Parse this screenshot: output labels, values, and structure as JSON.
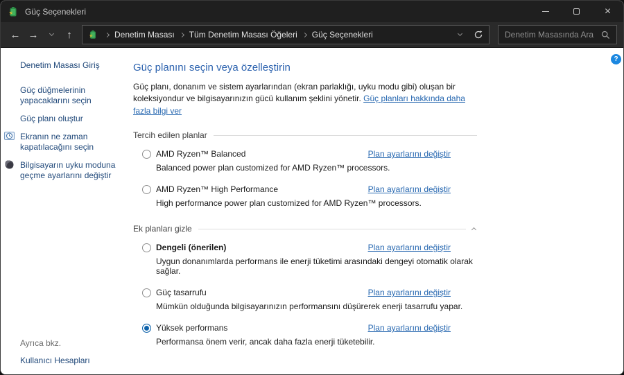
{
  "window": {
    "title": "Güç Seçenekleri"
  },
  "icons": {
    "back": "←",
    "forward": "→",
    "up": "↑",
    "close": "×",
    "help": "?",
    "power_icon_color": "#3aa650",
    "power_bolt_color": "#f2c230"
  },
  "navbar": {
    "breadcrumb": [
      "Denetim Masası",
      "Tüm Denetim Masası Öğeleri",
      "Güç Seçenekleri"
    ],
    "search": {
      "placeholder": "Denetim Masasında Ara"
    }
  },
  "sidebar": {
    "home": "Denetim Masası Giriş",
    "tasks": [
      {
        "label": "Güç düğmelerinin yapacaklarını seçin",
        "icon": ""
      },
      {
        "label": "Güç planı oluştur",
        "icon": ""
      },
      {
        "label": "Ekranın ne zaman kapatılacağını seçin",
        "icon": "display-clock-icon"
      },
      {
        "label": "Bilgisayarın uyku moduna geçme ayarlarını değiştir",
        "icon": "sleep-moon-icon"
      }
    ],
    "see_also": {
      "label": "Ayrıca bkz.",
      "links": [
        "Kullanıcı Hesapları"
      ]
    }
  },
  "main": {
    "heading": "Güç planını seçin veya özelleştirin",
    "intro_text": "Güç planı, donanım ve sistem ayarlarından (ekran parlaklığı, uyku modu gibi) oluşan bir koleksiyondur ve bilgisayarınızın gücü kullanım şeklini yönetir.",
    "intro_link": "Güç planları hakkında daha fazla bilgi ver",
    "groups": [
      {
        "title": "Tercih edilen planlar",
        "collapsible": false,
        "plans": [
          {
            "name": "AMD Ryzen™ Balanced",
            "description": "Balanced power plan customized for AMD Ryzen™ processors.",
            "selected": false,
            "bold": false,
            "link": "Plan ayarlarını değiştir"
          },
          {
            "name": "AMD Ryzen™ High Performance",
            "description": "High performance power plan customized for AMD Ryzen™ processors.",
            "selected": false,
            "bold": false,
            "link": "Plan ayarlarını değiştir"
          }
        ]
      },
      {
        "title": "Ek planları gizle",
        "collapsible": true,
        "plans": [
          {
            "name": "Dengeli (önerilen)",
            "description": "Uygun donanımlarda performans ile enerji tüketimi arasındaki dengeyi otomatik olarak sağlar.",
            "selected": false,
            "bold": true,
            "link": "Plan ayarlarını değiştir"
          },
          {
            "name": "Güç tasarrufu",
            "description": "Mümkün olduğunda bilgisayarınızın performansını düşürerek enerji tasarrufu yapar.",
            "selected": false,
            "bold": false,
            "link": "Plan ayarlarını değiştir"
          },
          {
            "name": "Yüksek performans",
            "description": "Performansa önem verir, ancak daha fazla enerji tüketebilir.",
            "selected": true,
            "bold": false,
            "link": "Plan ayarlarını değiştir"
          }
        ]
      }
    ]
  },
  "colors": {
    "titlebar_bg": "#1f1f1f",
    "navbar_bg": "#2a2a2a",
    "field_bg": "#1e1e1e",
    "content_bg": "#ffffff",
    "heading_blue": "#2d63af",
    "link_blue": "#2667b0",
    "sidebar_link": "#21497a",
    "radio_accent": "#0f63ab",
    "help_bg": "#1b87e0"
  }
}
